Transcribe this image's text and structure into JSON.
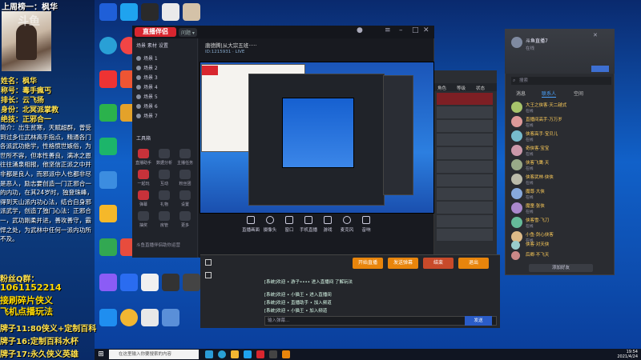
{
  "overlay": {
    "top_banner": "上周榜一：枫华",
    "watermark": "斗鱼",
    "profile": [
      {
        "label": "姓名：枫华"
      },
      {
        "label": "称号：毒手瘋丐"
      },
      {
        "label": "排长：云飞扬"
      },
      {
        "label": "身份：北冥派掌教"
      },
      {
        "label": "绝技：正邪合一"
      }
    ],
    "intro": "简介：出生贫寒，天赋超群，曾受到过多位武林高手指点，精通各门各派武功绝学，性格愤世嫉俗，为世所不容，但本性善良，满冰之恩往往涌泉相报，他坚信正派之中并非都是良人，而邪派中人也都非尽是恶人，励志要创造一门正邪合一的内功，在其24岁时，独登珠峰，得到天山派内功心法，结合自身邪派武学，创造了独门心法：正邪合一，武功刚柔并进，善攻善守，霸悍之处，为武林中任何一派内功所不及。",
    "fans_group_label": "粉丝Q群：",
    "fans_group_number": "1061152214",
    "promo1": "接刷碎片侠义",
    "promo2": "飞机点播玩法",
    "cards": [
      "牌子11:80侠义+定制百科",
      "牌子16:定制百科水杯",
      "牌子17:永久侠义英雄"
    ]
  },
  "window": {
    "logo": "直播伴侣",
    "version": "问题 ▾",
    "stream_title": "唐德腾|从大宗五班·····",
    "stream_sub": "ID:1215931  ·  LIVE",
    "sidebar_tabs": "场景  素材  设置",
    "scenes": [
      "场景 1",
      "场景 2",
      "场景 3",
      "场景 4",
      "场景 5",
      "场景 6",
      "场景 7"
    ],
    "toolbox_label": "工具箱",
    "tools": [
      "直播助手",
      "数据分析",
      "主播任务",
      "一起玩",
      "互动",
      "粉丝团",
      "弹幕",
      "礼物",
      "设置",
      "抽奖",
      "房管",
      "更多"
    ],
    "footer": "斗鱼直播伴侣助你运营",
    "bottom_tools": [
      "直播画面",
      "摄像头",
      "窗口",
      "手机直播",
      "游戏",
      "麦克风",
      "音响"
    ]
  },
  "game": {
    "headers": [
      "角色",
      "等级",
      "状态"
    ],
    "rows": 12
  },
  "chat": {
    "buttons": [
      {
        "label": "开始直播",
        "color": "#e8850c"
      },
      {
        "label": "发送弹幕",
        "color": "#e8850c"
      },
      {
        "label": "结束",
        "color": "#c84a2a"
      },
      {
        "label": "退出",
        "color": "#e8850c"
      }
    ],
    "lines": [
      "[系统]欢迎 • 游子•••• 进入直播间 了解玩法",
      "[系统]欢迎 • 小猫王 • 进入直播间",
      "[系统]欢迎 • 直播助手 • 加入频道",
      "[系统]欢迎 • 小猫王 • 加入频道"
    ],
    "input_placeholder": "输入弹幕...",
    "send_label": "发送"
  },
  "qq": {
    "name": "斗鱼直播7",
    "status": "在线",
    "search_placeholder": "搜索",
    "tabs": [
      "消息",
      "联系人",
      "空间"
    ],
    "active_tab": "联系人",
    "contacts": [
      {
        "name": "大王之侠客·天二越式",
        "status": "在线"
      },
      {
        "name": "直播间高手·万万岁",
        "status": "在线"
      },
      {
        "name": "侠客高手·宝贝儿",
        "status": "在线"
      },
      {
        "name": "奇侠客·宝宝",
        "status": "在线"
      },
      {
        "name": "侠客飞鹰·天",
        "status": "在线"
      },
      {
        "name": "侠客武林·侠侠",
        "status": "在线"
      },
      {
        "name": "魔尊·大侠",
        "status": "在线"
      },
      {
        "name": "魔童·张侠",
        "status": "在线"
      },
      {
        "name": "侠客雪·飞刀",
        "status": "在线"
      },
      {
        "name": "小鱼·剑心侠客",
        "status": "在线"
      },
      {
        "name": "侠客·对天侠",
        "status": "在线"
      },
      {
        "name": "后卿·不飞天",
        "status": "在线"
      }
    ],
    "footer_button": "添加好友"
  },
  "taskbar": {
    "search_placeholder": "在这里输入你要搜索的内容",
    "time": "19:54",
    "date": "2021/4/24"
  },
  "colors": {
    "accent": "#e8850c",
    "brand_red": "#d8262f",
    "highlight_yellow": "#ffd900"
  }
}
